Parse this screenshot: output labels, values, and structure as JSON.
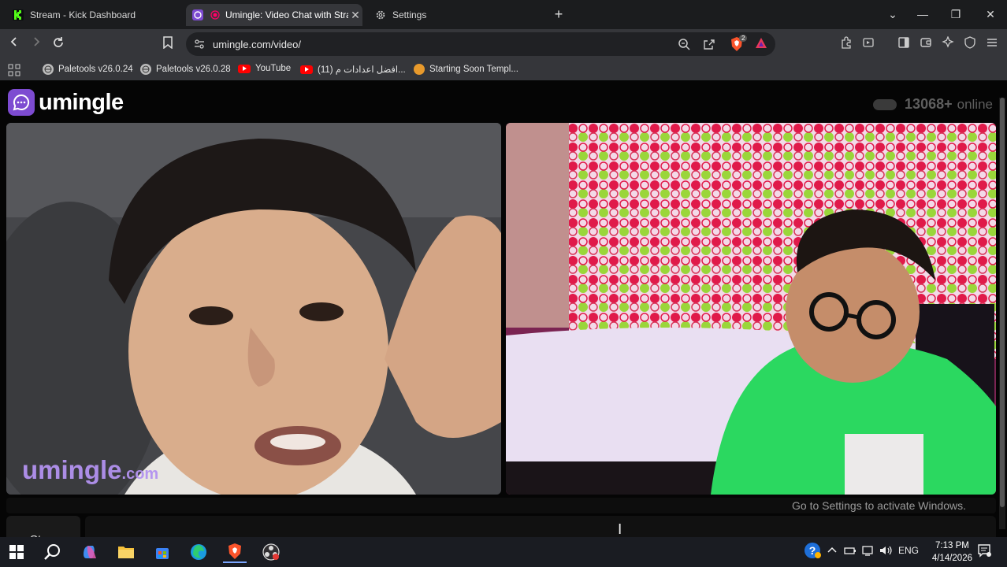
{
  "browser": {
    "tabs": [
      {
        "title": "Stream - Kick Dashboard",
        "active": false
      },
      {
        "title": "Umingle: Video Chat with Strangers",
        "active": true
      },
      {
        "title": "Settings",
        "active": false
      }
    ],
    "new_tab_icon": "plus-icon",
    "url": "umingle.com/video/",
    "shield_badge": "2",
    "bookmarks": [
      {
        "label": "Paletools v26.0.24",
        "icon": "globe-icon"
      },
      {
        "label": "Paletools v26.0.28",
        "icon": "globe-icon"
      },
      {
        "label": "YouTube",
        "icon": "youtube-icon"
      },
      {
        "label": "(11) افضل اعدادات م...",
        "icon": "youtube-icon"
      },
      {
        "label": "Starting Soon Templ...",
        "icon": "site-icon"
      }
    ]
  },
  "page": {
    "logo_text": "umingle",
    "online_count": "13068+",
    "online_label": "online",
    "watermark_text": "umingle",
    "watermark_suffix": ".com",
    "stop_label": "Stop",
    "activate_windows": "Go to Settings to activate Windows."
  },
  "taskbar": {
    "language": "ENG",
    "time": "7:13 PM",
    "date": "4/14/2026"
  },
  "colors": {
    "accent": "#7d4bd1",
    "watermark": "#b392f0",
    "kick_green": "#53fc18",
    "brave_orange": "#fb542b"
  }
}
